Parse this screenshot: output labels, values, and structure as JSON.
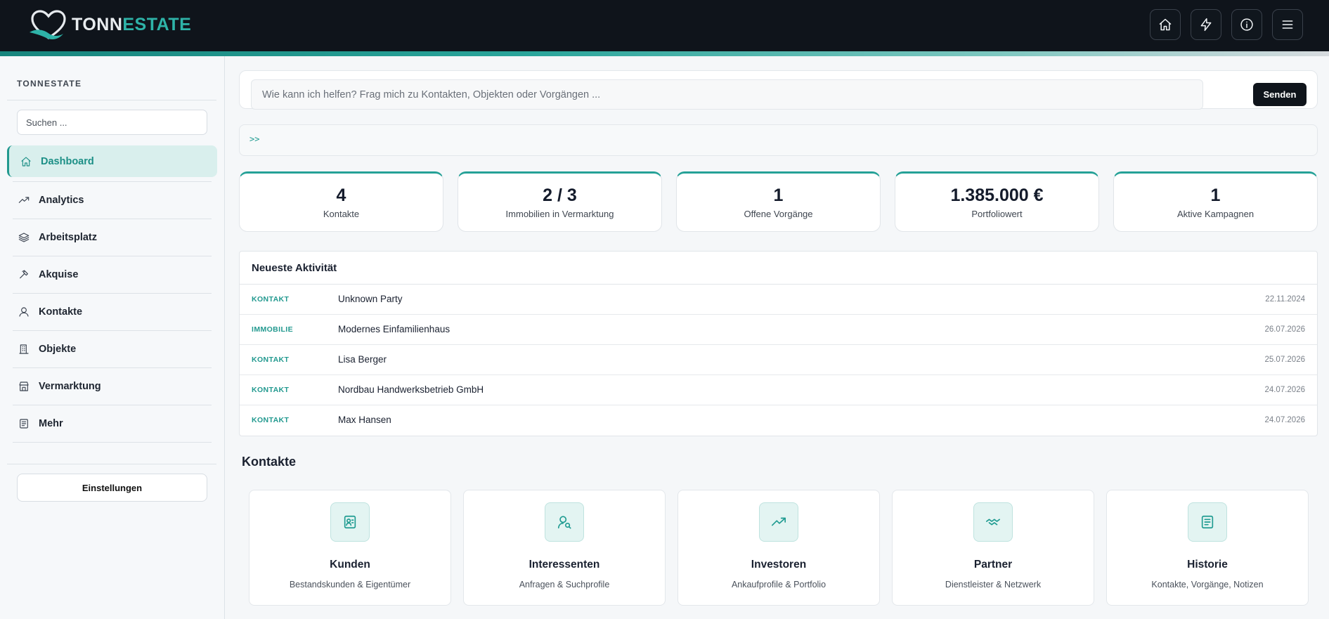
{
  "brand": {
    "name_part1": "TONN",
    "name_part2": "ESTATE",
    "accent_color": "#2eb3a8"
  },
  "header": {
    "actions": [
      {
        "icon": "home-icon",
        "name": "home-button"
      },
      {
        "icon": "lightning-icon",
        "name": "quick-actions-button"
      },
      {
        "icon": "info-icon",
        "name": "info-button"
      },
      {
        "icon": "menu-icon",
        "name": "menu-button"
      }
    ]
  },
  "sidebar": {
    "brand_label": "TONNESTATE",
    "search_placeholder": "Suchen ...",
    "items": [
      {
        "label": "Dashboard",
        "icon": "home-icon",
        "active": true
      },
      {
        "label": "Analytics",
        "icon": "trend-icon"
      },
      {
        "label": "Arbeitsplatz",
        "icon": "layers-icon"
      },
      {
        "label": "Akquise",
        "icon": "hammer-icon"
      },
      {
        "label": "Kontakte",
        "icon": "user-icon"
      },
      {
        "label": "Objekte",
        "icon": "building-icon"
      },
      {
        "label": "Vermarktung",
        "icon": "store-icon"
      },
      {
        "label": "Mehr",
        "icon": "list-icon"
      }
    ],
    "settings_label": "Einstellungen"
  },
  "assistant": {
    "placeholder": "Wie kann ich helfen? Frag mich zu Kontakten, Objekten oder Vorgängen ...",
    "send_label": "Senden",
    "prompt_marker": ">>"
  },
  "stats": [
    {
      "value": "4",
      "label": "Kontakte"
    },
    {
      "value": "2 / 3",
      "label": "Immobilien in Vermarktung"
    },
    {
      "value": "1",
      "label": "Offene Vorgänge"
    },
    {
      "value": "1.385.000 €",
      "label": "Portfoliowert"
    },
    {
      "value": "1",
      "label": "Aktive Kampagnen"
    }
  ],
  "activity": {
    "title": "Neueste Aktivität",
    "rows": [
      {
        "type": "KONTAKT",
        "name": "Unknown Party",
        "date": "22.11.2024"
      },
      {
        "type": "IMMOBILIE",
        "name": "Modernes Einfamilienhaus",
        "date": "26.07.2026"
      },
      {
        "type": "KONTAKT",
        "name": "Lisa Berger",
        "date": "25.07.2026"
      },
      {
        "type": "KONTAKT",
        "name": "Nordbau Handwerksbetrieb GmbH",
        "date": "24.07.2026"
      },
      {
        "type": "KONTAKT",
        "name": "Max Hansen",
        "date": "24.07.2026"
      }
    ]
  },
  "contacts_section": {
    "title": "Kontakte",
    "cards": [
      {
        "title": "Kunden",
        "subtitle": "Bestandskunden & Eigentümer",
        "icon": "contact-card-icon"
      },
      {
        "title": "Interessenten",
        "subtitle": "Anfragen & Suchprofile",
        "icon": "user-search-icon"
      },
      {
        "title": "Investoren",
        "subtitle": "Ankaufprofile & Portfolio",
        "icon": "trend-up-icon"
      },
      {
        "title": "Partner",
        "subtitle": "Dienstleister & Netzwerk",
        "icon": "handshake-icon"
      },
      {
        "title": "Historie",
        "subtitle": "Kontakte, Vorgänge, Notizen",
        "icon": "notes-icon"
      }
    ]
  }
}
